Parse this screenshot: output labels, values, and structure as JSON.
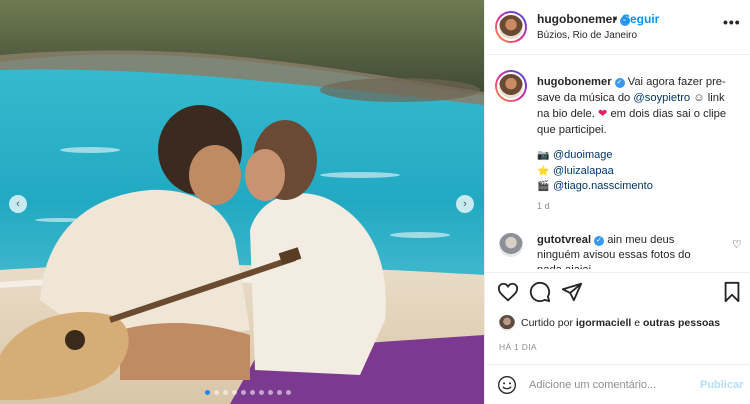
{
  "post": {
    "username": "hugobonemer",
    "follow_label": "Seguir",
    "separator": "•",
    "location": "Búzios, Rio de Janeiro",
    "more_label": "•••"
  },
  "caption": {
    "username": "hugobonemer",
    "text_before": " Vai agora fazer pre-save da música do ",
    "mention": "@soypietro",
    "text_mid": " ☺ link na bio dele. ",
    "text_after": " em dois dias sai o clipe que participei.",
    "credits": [
      {
        "icon": "📷",
        "handle": "@duoimage"
      },
      {
        "icon": "⭐",
        "handle": "@luizalapaa"
      },
      {
        "icon": "🎬",
        "handle": "@tiago.nasscimento"
      }
    ],
    "time": "1 d"
  },
  "comment": {
    "username": "gutotvreal",
    "text": " ain meu deus ninguém avisou essas fotos do nada aiaiai"
  },
  "likes": {
    "prefix": "Curtido por ",
    "user": "igormaciell",
    "middle": " e ",
    "others": "outras pessoas"
  },
  "timestamp": "HÁ 1 DIA",
  "add_comment": {
    "placeholder": "Adicione um comentário...",
    "publish_label": "Publicar"
  },
  "carousel": {
    "slide_count": 10,
    "active_index": 0
  },
  "colors": {
    "accent": "#0095f6",
    "verified": "#3897f0",
    "heart": "#e0245e",
    "publish_disabled": "#b2dffc"
  }
}
